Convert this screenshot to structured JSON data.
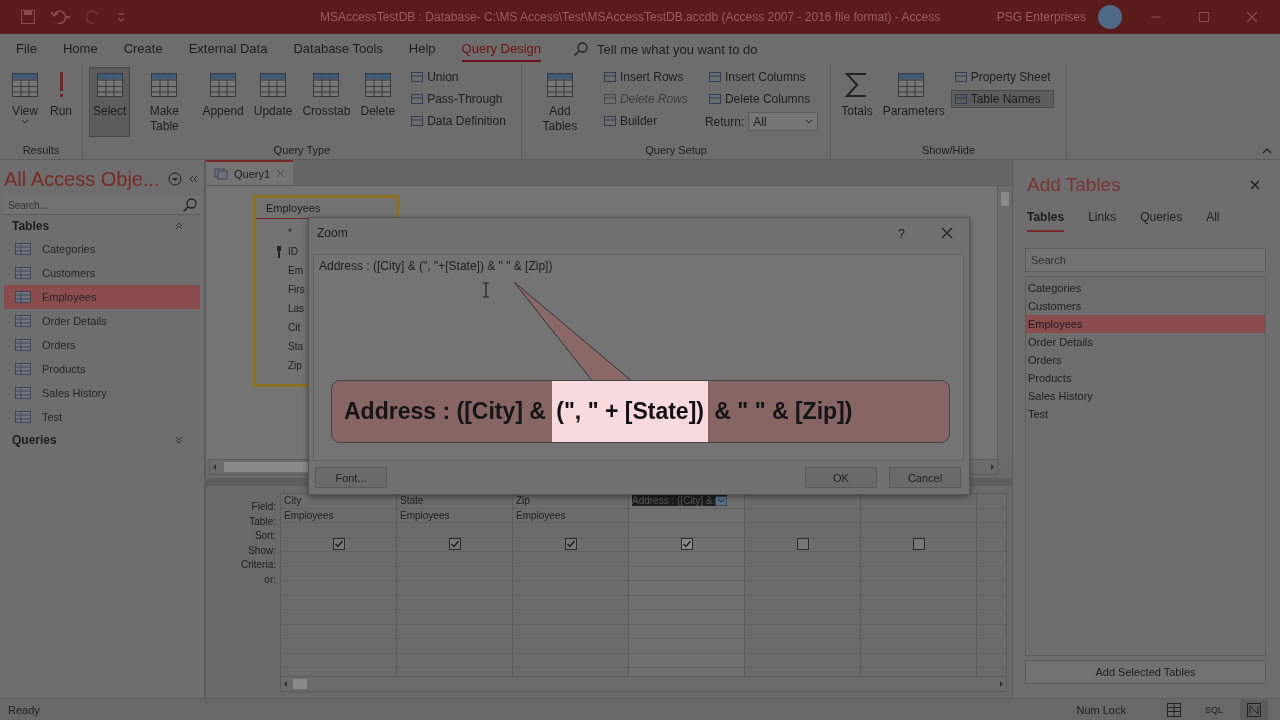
{
  "title_bar": {
    "title": "MSAccessTestDB : Database- C:\\MS Access\\Test\\MSAccessTestDB.accdb (Access 2007 - 2016 file format) - Access",
    "account": "PSG Enterprises"
  },
  "menu_tabs": [
    {
      "label": "File",
      "selected": false
    },
    {
      "label": "Home",
      "selected": false
    },
    {
      "label": "Create",
      "selected": false
    },
    {
      "label": "External Data",
      "selected": false
    },
    {
      "label": "Database Tools",
      "selected": false
    },
    {
      "label": "Help",
      "selected": false
    },
    {
      "label": "Query Design",
      "selected": true
    }
  ],
  "tell_me": {
    "placeholder": "Tell me what you want to do"
  },
  "ribbon": [
    {
      "label": "Results",
      "items": [
        {
          "kind": "grid",
          "label": "View",
          "dropdown": true,
          "selected": false
        },
        {
          "kind": "run",
          "label": "Run",
          "dropdown": false,
          "selected": false
        }
      ]
    },
    {
      "label": "Query Type",
      "items": [
        {
          "kind": "grid",
          "label": "Select",
          "dropdown": false,
          "selected": true
        },
        {
          "kind": "grid",
          "label": "Make Table",
          "dropdown": false,
          "selected": false
        },
        {
          "kind": "grid",
          "label": "Append",
          "dropdown": false,
          "selected": false
        },
        {
          "kind": "grid",
          "label": "Update",
          "dropdown": false,
          "selected": false
        },
        {
          "kind": "grid",
          "label": "Crosstab",
          "dropdown": false,
          "selected": false
        },
        {
          "kind": "grid",
          "label": "Delete",
          "dropdown": false,
          "selected": false
        },
        {
          "kind": "stack",
          "items": [
            {
              "kind": "small",
              "label": "Union",
              "disabled": false,
              "selected": false
            },
            {
              "kind": "small",
              "label": "Pass-Through",
              "disabled": false,
              "selected": false
            },
            {
              "kind": "small",
              "label": "Data Definition",
              "disabled": false,
              "selected": false
            }
          ]
        }
      ]
    },
    {
      "label": "Query Setup",
      "items": [
        {
          "kind": "grid",
          "label": "Add Tables",
          "dropdown": false,
          "selected": false
        },
        {
          "kind": "stack",
          "items": [
            {
              "kind": "small",
              "label": "Insert Rows",
              "disabled": false,
              "selected": false
            },
            {
              "kind": "small",
              "label": "Delete Rows",
              "disabled": true,
              "selected": false
            },
            {
              "kind": "small",
              "label": "Builder",
              "disabled": false,
              "selected": false
            }
          ]
        },
        {
          "kind": "stack",
          "items": [
            {
              "kind": "small",
              "label": "Insert Columns",
              "disabled": false,
              "selected": false
            },
            {
              "kind": "small",
              "label": "Delete Columns",
              "disabled": false,
              "selected": false
            },
            {
              "kind": "combo",
              "label": "Return:",
              "value": "All"
            }
          ]
        }
      ]
    },
    {
      "label": "Show/Hide",
      "items": [
        {
          "kind": "sigma",
          "label": "Totals",
          "dropdown": false,
          "selected": false
        },
        {
          "kind": "grid",
          "label": "Parameters",
          "dropdown": false,
          "selected": false
        },
        {
          "kind": "stack",
          "items": [
            {
              "kind": "small",
              "label": "Property Sheet",
              "disabled": false,
              "selected": false
            },
            {
              "kind": "small",
              "label": "Table Names",
              "disabled": false,
              "selected": true
            }
          ]
        }
      ]
    }
  ],
  "nav_pane": {
    "title": "All Access Obje...",
    "search": {
      "placeholder": "Search..."
    },
    "sections": [
      {
        "label": "Tables",
        "expanded": true,
        "items": [
          {
            "label": "Categories",
            "selected": false
          },
          {
            "label": "Customers",
            "selected": false
          },
          {
            "label": "Employees",
            "selected": true
          },
          {
            "label": "Order Details",
            "selected": false
          },
          {
            "label": "Orders",
            "selected": false
          },
          {
            "label": "Products",
            "selected": false
          },
          {
            "label": "Sales History",
            "selected": false
          },
          {
            "label": "Test",
            "selected": false
          }
        ]
      },
      {
        "label": "Queries",
        "expanded": false
      }
    ]
  },
  "document_tabs": [
    {
      "label": "Query1",
      "selected": true
    }
  ],
  "design_table": {
    "title": "Employees",
    "fields": [
      {
        "name": "*",
        "key": false
      },
      {
        "name": "ID",
        "key": true
      },
      {
        "name": "Em",
        "key": false
      },
      {
        "name": "Firs",
        "key": false
      },
      {
        "name": "Las",
        "key": false
      },
      {
        "name": "Cit",
        "key": false
      },
      {
        "name": "Sta",
        "key": false
      },
      {
        "name": "Zip",
        "key": false
      }
    ]
  },
  "grid": {
    "row_labels": [
      "Field:",
      "Table:",
      "Sort:",
      "Show:",
      "Criteria:",
      "or:"
    ],
    "columns": [
      {
        "field": "City",
        "table": "Employees",
        "show": true,
        "selected": false
      },
      {
        "field": "State",
        "table": "Employees",
        "show": true,
        "selected": false
      },
      {
        "field": "Zip",
        "table": "Employees",
        "show": true,
        "selected": false
      },
      {
        "field": "Address : ([City] &",
        "show": true,
        "selected": true
      },
      {
        "show": false,
        "selected": false
      },
      {
        "show": false,
        "selected": false
      }
    ]
  },
  "zoom_dialog": {
    "title": "Zoom",
    "help": "?",
    "expression": "Address : ([City] & (\", \"+[State]) & \" \" & [Zip])",
    "buttons": [
      "Font...",
      "OK",
      "Cancel"
    ]
  },
  "callout": {
    "before": "Address : ([City] & ",
    "highlight": "(\", \" + [State])",
    "after": " & \" \" & [Zip])"
  },
  "add_tables": {
    "title": "Add Tables",
    "tabs": [
      {
        "label": "Tables",
        "selected": true
      },
      {
        "label": "Links",
        "selected": false
      },
      {
        "label": "Queries",
        "selected": false
      },
      {
        "label": "All",
        "selected": false
      }
    ],
    "search": {
      "placeholder": "Search"
    },
    "items": [
      {
        "label": "Categories",
        "selected": false
      },
      {
        "label": "Customers",
        "selected": false
      },
      {
        "label": "Employees",
        "selected": true
      },
      {
        "label": "Order Details",
        "selected": false
      },
      {
        "label": "Orders",
        "selected": false
      },
      {
        "label": "Products",
        "selected": false
      },
      {
        "label": "Sales History",
        "selected": false
      },
      {
        "label": "Test",
        "selected": false
      }
    ],
    "button": "Add Selected Tables"
  },
  "status_bar": {
    "text": "Ready",
    "indicator": "Num Lock",
    "views": [
      {
        "kind": "datasheet",
        "selected": false
      },
      {
        "kind": "sql",
        "label": "SQL",
        "selected": false
      },
      {
        "kind": "design",
        "selected": true
      }
    ]
  }
}
